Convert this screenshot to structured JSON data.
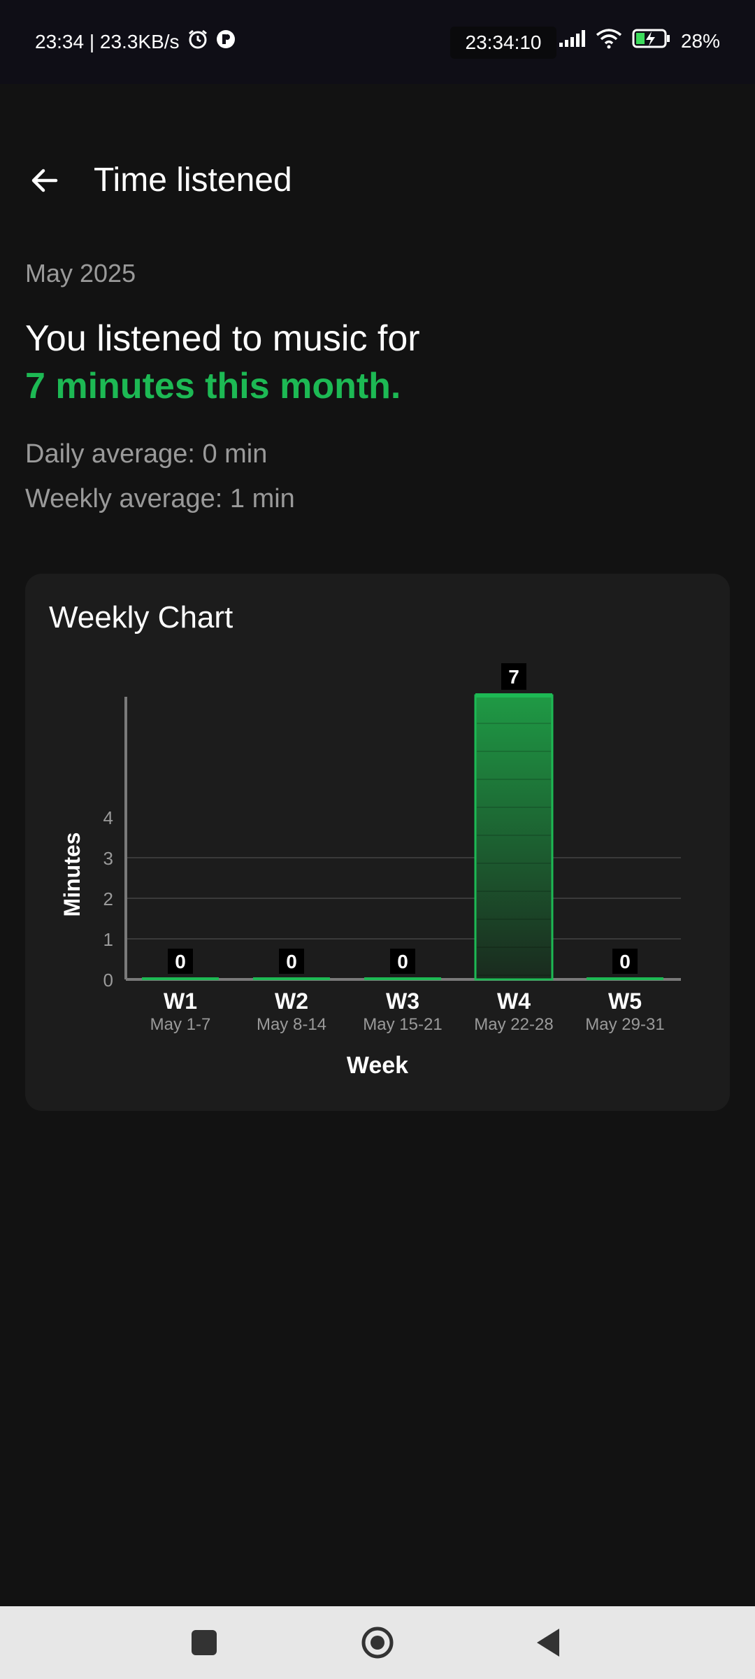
{
  "status": {
    "left_text": "23:34 | 23.3KB/s",
    "clock": "23:34:10",
    "battery": "28%",
    "icons": [
      "alarm-icon",
      "app-notification-icon",
      "signal-icon",
      "wifi-icon",
      "battery-charging-icon"
    ]
  },
  "header": {
    "title": "Time listened",
    "back_icon": "back-arrow-icon"
  },
  "summary": {
    "period": "May 2025",
    "line1": "You listened to music for",
    "line2": "7 minutes this month.",
    "daily": "Daily average: 0 min",
    "weekly": "Weekly average: 1 min"
  },
  "colors": {
    "accent": "#1db954",
    "bar_fill_top": "#1f9a45",
    "bar_fill_bottom": "#1a2a1e",
    "card": "#1c1c1c",
    "background": "#121212"
  },
  "chart": {
    "title": "Weekly Chart"
  },
  "chart_data": {
    "type": "bar",
    "title": "Weekly Chart",
    "xlabel": "Week",
    "ylabel": "Minutes",
    "categories": [
      "W1",
      "W2",
      "W3",
      "W4",
      "W5"
    ],
    "subcategories": [
      "May 1-7",
      "May 8-14",
      "May 15-21",
      "May 22-28",
      "May 29-31"
    ],
    "values": [
      0,
      0,
      0,
      7,
      0
    ],
    "yticks": [
      "0",
      "1",
      "2",
      "3",
      "4"
    ],
    "grid": true,
    "legend": "none"
  },
  "nav": {
    "buttons": [
      "recents-square-icon",
      "home-circle-icon",
      "back-triangle-icon"
    ]
  }
}
